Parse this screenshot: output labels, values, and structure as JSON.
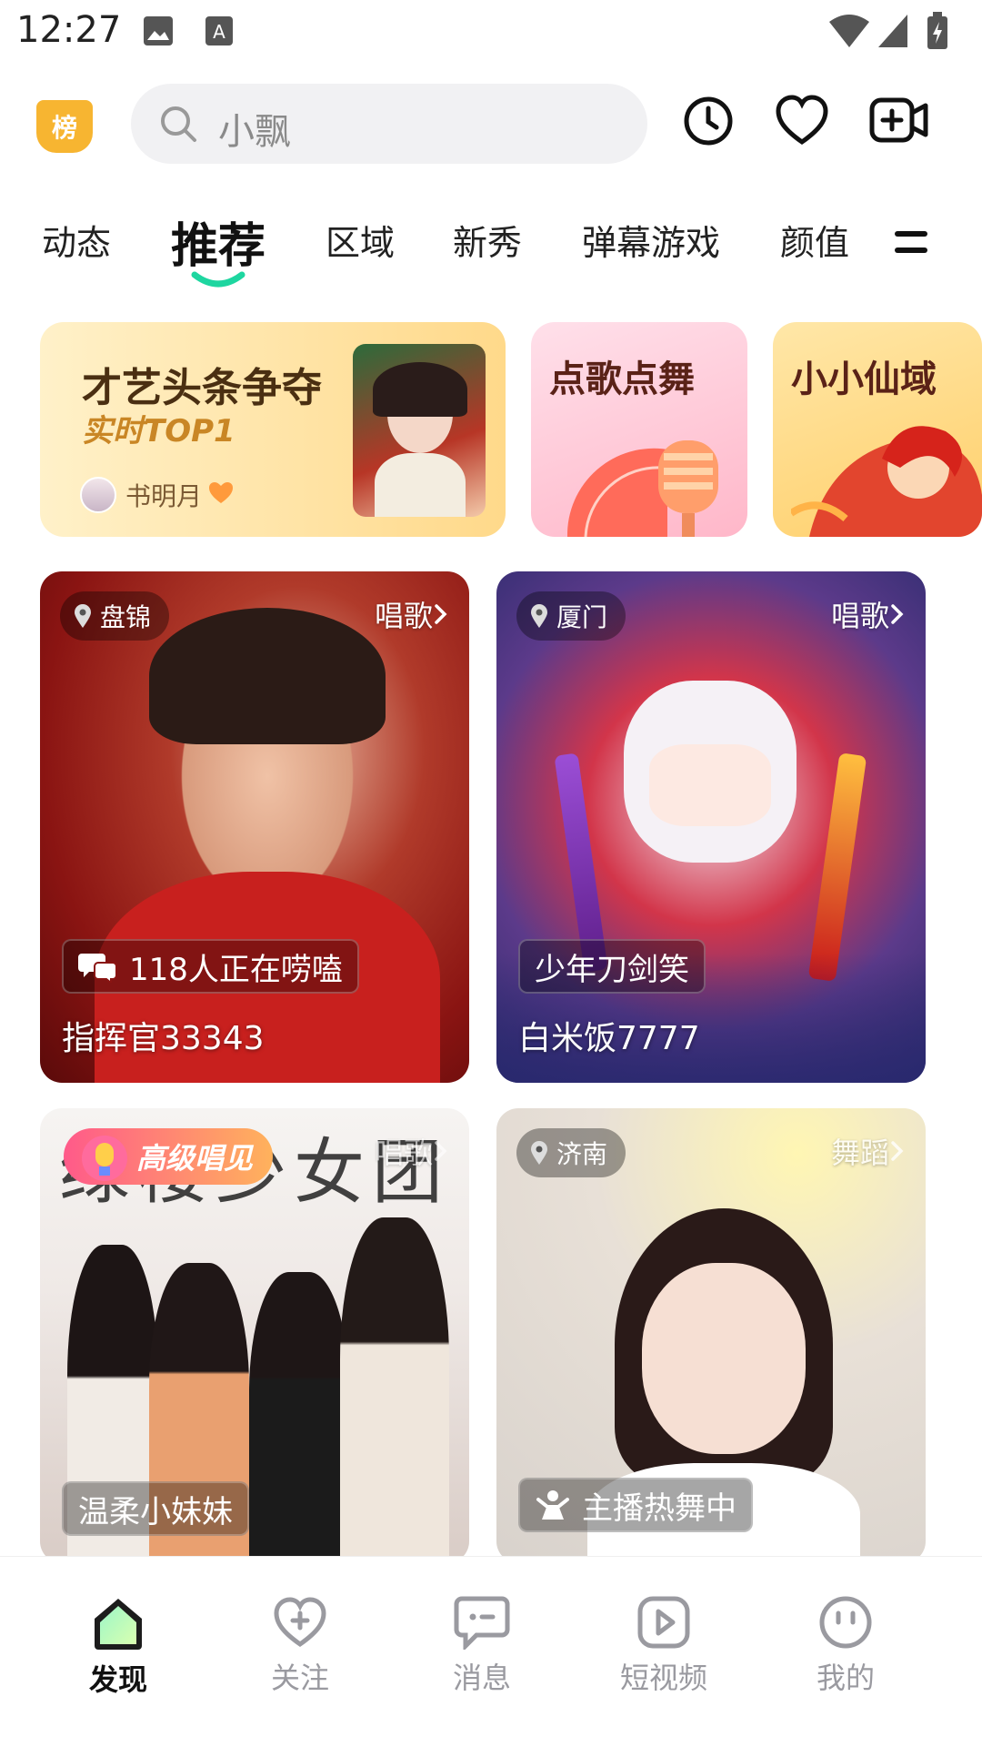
{
  "status_bar": {
    "time": "12:27"
  },
  "header": {
    "rank_badge": "榜",
    "search_placeholder": "小飘"
  },
  "tabs": [
    {
      "label": "动态"
    },
    {
      "label": "推荐"
    },
    {
      "label": "区域"
    },
    {
      "label": "新秀"
    },
    {
      "label": "弹幕游戏"
    },
    {
      "label": "颜值"
    }
  ],
  "banners": [
    {
      "title": "才艺头条争夺",
      "subtitle": "实时TOP1",
      "user": "书明月"
    },
    {
      "title": "点歌点舞"
    },
    {
      "title": "小小仙域"
    }
  ],
  "streams": [
    {
      "location": "盘锦",
      "category": "唱歌",
      "pill": "118人正在唠嗑",
      "name": "指挥官33343"
    },
    {
      "location": "厦门",
      "category": "唱歌",
      "pill": "少年刀剑笑",
      "name": "白米饭7777"
    },
    {
      "badge": "高级唱见",
      "category": "唱歌",
      "title_art": "绿楼少女团",
      "pill": "温柔小妹妹"
    },
    {
      "location": "济南",
      "category": "舞蹈",
      "pill": "主播热舞中"
    }
  ],
  "bottom_nav": [
    {
      "label": "发现"
    },
    {
      "label": "关注"
    },
    {
      "label": "消息"
    },
    {
      "label": "短视频"
    },
    {
      "label": "我的"
    }
  ],
  "colors": {
    "accent": "#1ed6a0",
    "rank": "#f7b531"
  }
}
